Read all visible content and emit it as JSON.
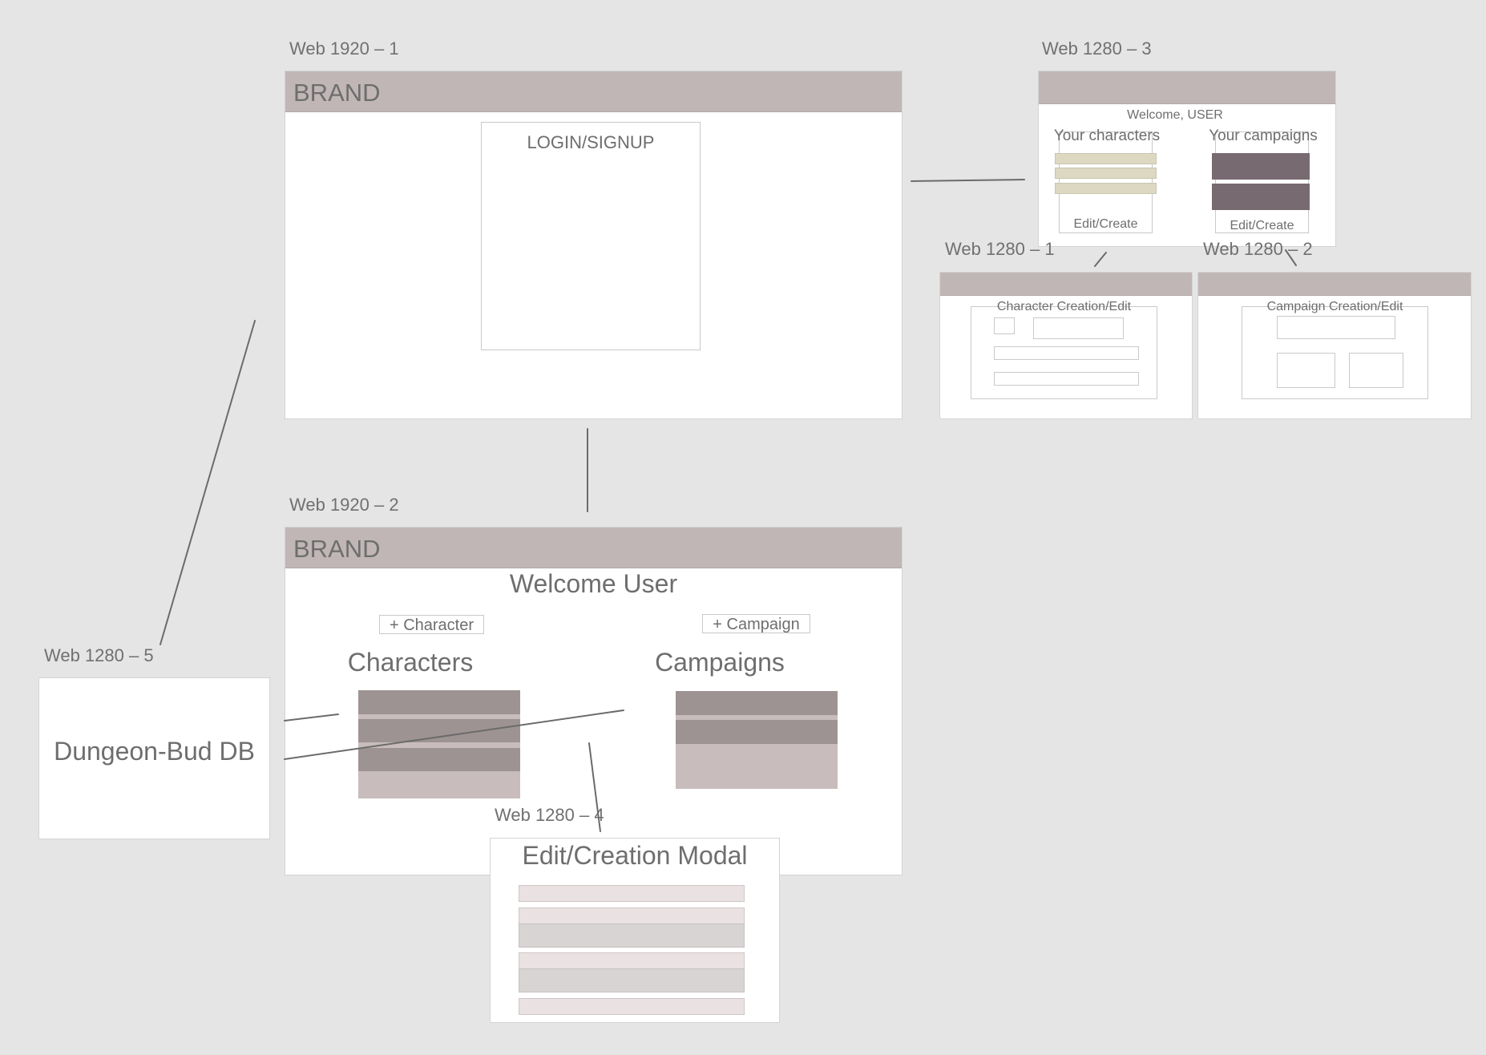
{
  "labels": {
    "web1920_1": "Web 1920 – 1",
    "web1920_2": "Web 1920 – 2",
    "web1280_1": "Web 1280 – 1",
    "web1280_2": "Web 1280 – 2",
    "web1280_3": "Web 1280 – 3",
    "web1280_4": "Web 1280 – 4",
    "web1280_5": "Web 1280 – 5"
  },
  "login_frame": {
    "brand": "BRAND",
    "login_box_title": "LOGIN/SIGNUP"
  },
  "dashboard_frame": {
    "brand": "BRAND",
    "welcome": "Welcome User",
    "add_character": "+ Character",
    "add_campaign": "+ Campaign",
    "characters_heading": "Characters",
    "campaigns_heading": "Campaigns"
  },
  "compact_dashboard": {
    "welcome": "Welcome, USER",
    "your_characters": "Your characters",
    "your_campaigns": "Your campaigns",
    "edit_create_characters": "Edit/Create",
    "edit_create_campaigns": "Edit/Create"
  },
  "character_frame": {
    "title": "Character Creation/Edit"
  },
  "campaign_frame": {
    "title": "Campaign Creation/Edit"
  },
  "modal_frame": {
    "title": "Edit/Creation Modal"
  },
  "db_frame": {
    "title": "Dungeon-Bud DB"
  },
  "colors": {
    "canvas": "#e5e5e5",
    "brand_bar": "#c1b6b6",
    "row_dark": "#9e9393",
    "row_light": "#c8bcbc",
    "row_plum": "#776a70",
    "row_sage": "#dcd8c2",
    "connector": "#6b6b6b"
  }
}
